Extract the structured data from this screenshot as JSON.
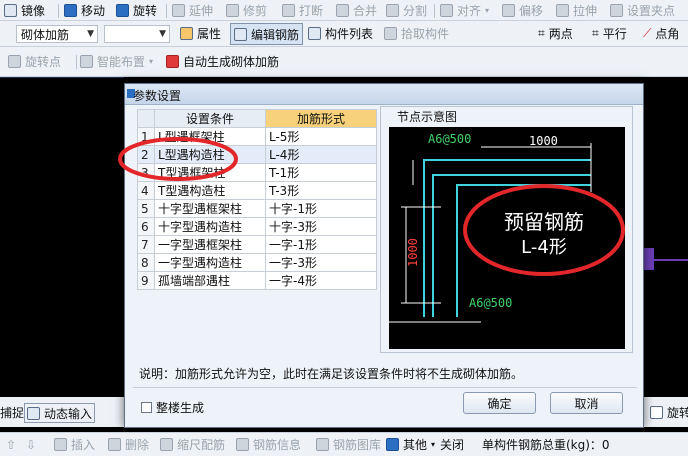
{
  "toolbar1": {
    "mirror": "镜像",
    "move": "移动",
    "rotate": "旋转",
    "extend": "延伸",
    "trim": "修剪",
    "break": "打断",
    "merge": "合并",
    "split": "分割",
    "align": "对齐",
    "offset": "偏移",
    "stretch": "拉伸",
    "grip": "设置夹点"
  },
  "toolbar2": {
    "combo1": "砌体加筋",
    "combo2": "",
    "properties": "属性",
    "edit_rebar": "编辑钢筋",
    "component_list": "构件列表",
    "pick_component": "拾取构件",
    "two_points": "两点",
    "parallel": "平行",
    "point_angle": "点角"
  },
  "toolbar3": {
    "rotate_point": "旋转点",
    "smart_layout": "智能布置",
    "auto_generate": "自动生成砌体加筋"
  },
  "dialog": {
    "title": "参数设置",
    "col_condition": "设置条件",
    "col_form": "加筋形式",
    "rows": [
      {
        "n": "1",
        "condition": "L型遇框架柱",
        "form": "L-5形"
      },
      {
        "n": "2",
        "condition": "L型遇构造柱",
        "form": "L-4形"
      },
      {
        "n": "3",
        "condition": "T型遇框架柱",
        "form": "T-1形"
      },
      {
        "n": "4",
        "condition": "T型遇构造柱",
        "form": "T-3形"
      },
      {
        "n": "5",
        "condition": "十字型遇框架柱",
        "form": "十字-1形"
      },
      {
        "n": "6",
        "condition": "十字型遇构造柱",
        "form": "十字-3形"
      },
      {
        "n": "7",
        "condition": "一字型遇框架柱",
        "form": "一字-1形"
      },
      {
        "n": "8",
        "condition": "一字型遇构造柱",
        "form": "一字-3形"
      },
      {
        "n": "9",
        "condition": "孤墙端部遇柱",
        "form": "一字-4形"
      }
    ],
    "preview_title": "节点示意图",
    "preview_label_a": "A6@500",
    "preview_label_b": "A6@500",
    "preview_dim_h": "1000",
    "preview_dim_v": "1000",
    "annotation_line1": "预留钢筋",
    "annotation_line2": "L-4形",
    "note": "说明：加筋形式允许为空，此时在满足该设置条件时将不生成砌体加筋。",
    "whole_floor": "整楼生成",
    "ok": "确定",
    "cancel": "取消"
  },
  "left_bottom": {
    "snap": "捕捉",
    "dynamic_input": "动态输入"
  },
  "right_bottom": {
    "rotate": "旋转"
  },
  "statusbar": {
    "insert": "插入",
    "delete": "删除",
    "scale_rebar": "缩尺配筋",
    "rebar_info": "钢筋信息",
    "rebar_library": "钢筋图库",
    "other": "其他",
    "close": "关闭",
    "total_label": "单构件钢筋总重(kg)：0"
  },
  "colors": {
    "accent": "#2c6fc2",
    "highlight_header": "#f8d27a",
    "annotation_red": "#e3262a",
    "rebar_cyan": "#3fd3e0"
  }
}
